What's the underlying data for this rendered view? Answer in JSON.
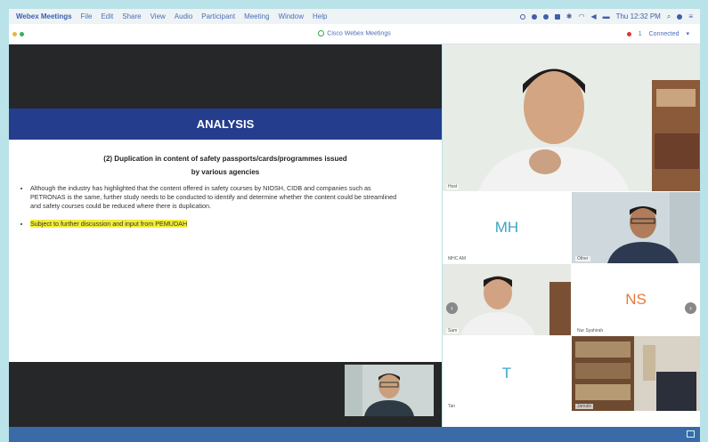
{
  "menubar": {
    "app_name": "Webex Meetings",
    "items": [
      "File",
      "Edit",
      "Share",
      "View",
      "Audio",
      "Participant",
      "Meeting",
      "Window",
      "Help"
    ],
    "clock": "Thu 12:32 PM"
  },
  "window": {
    "title": "Cisco Webex Meetings",
    "status_count": "1",
    "connection": "Connected"
  },
  "slide": {
    "heading": "ANALYSIS",
    "subtitle_line1": "(2) Duplication in content of safety passports/cards/programmes issued",
    "subtitle_line2": "by various agencies",
    "bullet1": "Although the industry has highlighted that the content offered in safety courses by NIOSH, CIDB and companies such as PETRONAS is the same, further study needs to be conducted to identify and determine whether the content could be streamlined and safety courses could be reduced where there is duplication.",
    "bullet2": "Subject to further discussion and input from PEMUDAH"
  },
  "participants": [
    {
      "label": "Host"
    },
    {
      "initials": "MH",
      "label": "MHC AM"
    },
    {
      "label": "Other"
    },
    {
      "label": "Sam"
    },
    {
      "initials": "NS",
      "label": "Nur Syahirah"
    },
    {
      "initials": "T",
      "label": "Tan"
    },
    {
      "label": "Jamale"
    }
  ],
  "colors": {
    "slide_band": "#243d8c",
    "highlight": "#f3ee36",
    "initials_mh": "#3aa6c4",
    "initials_ns": "#e57a3c",
    "initials_t": "#3aa6c4"
  }
}
